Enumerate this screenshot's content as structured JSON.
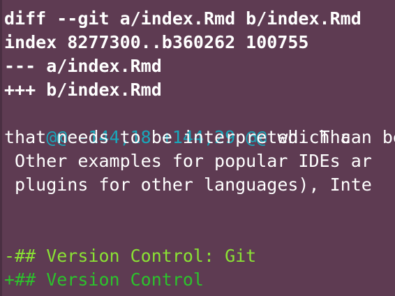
{
  "diff": {
    "header": "diff --git a/index.Rmd b/index.Rmd",
    "index_line": "index 8277300..b360262 100755",
    "old_file": "--- a/index.Rmd",
    "new_file": "+++ b/index.Rmd",
    "hunk_header": "@@ -144,18 +144,29 @@",
    "hunk_context": " which can be",
    "context_lines": [
      "that needs to be interpreted. Tha",
      " Other examples for popular IDEs ar",
      " plugins for other languages), Inte"
    ],
    "removed_line": "-## Version Control: Git",
    "added_line": "+## Version Control"
  },
  "colors": {
    "background": "#5e3b52",
    "text": "#ffffff",
    "hunk": "#19a7ba",
    "removed": "#8ae234",
    "added": "#2cc22c"
  }
}
